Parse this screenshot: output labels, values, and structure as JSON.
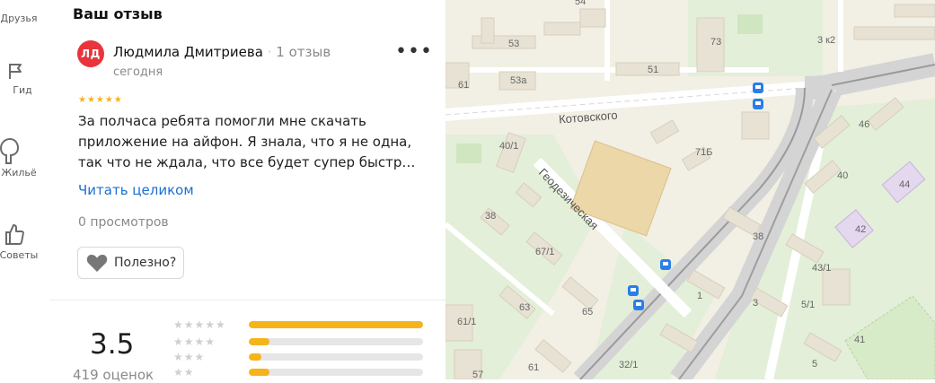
{
  "sidebar": {
    "items": [
      {
        "label": "Друзья",
        "icon": "friends-icon"
      },
      {
        "label": "Гид",
        "icon": "flag-icon"
      },
      {
        "label": "Жильё",
        "icon": "house-icon"
      },
      {
        "label": "Советы",
        "icon": "thumbs-up-icon"
      }
    ]
  },
  "panel": {
    "title": "Ваш отзыв",
    "review": {
      "avatar_initials": "ЛД",
      "author": "Людмила Дмитриева",
      "separator": "·",
      "author_reviews": "1 отзыв",
      "date": "сегодня",
      "stars": "★★★★★",
      "text": "За полчаса ребята помогли мне скачать приложение на айфон. Я знала, что я не одна, так что не ждала, что все будет супер быстр…",
      "read_more": "Читать целиком",
      "views": "0 просмотров",
      "helpful": "Полезно?",
      "more": "•••"
    },
    "rating": {
      "value": "3.5",
      "count": "419 оценок",
      "distribution": [
        {
          "stars": "★★★★★",
          "fraction": 1.0
        },
        {
          "stars": "★★★★",
          "fraction": 0.12
        },
        {
          "stars": "★★★",
          "fraction": 0.07
        },
        {
          "stars": "★★",
          "fraction": 0.12
        }
      ]
    }
  },
  "map": {
    "streets": [
      "Котовского",
      "Геодезическая"
    ],
    "buildings": [
      "54",
      "53",
      "73",
      "3 к2",
      "51",
      "61",
      "53а",
      "46",
      "40/1",
      "71Б",
      "40",
      "44",
      "38",
      "38",
      "42",
      "67/1",
      "43/1",
      "1",
      "5/1",
      "63",
      "65",
      "3",
      "61/1",
      "41",
      "57",
      "61",
      "32/1",
      "5"
    ]
  },
  "colors": {
    "accent": "#f5b41a",
    "link": "#1d6fd1",
    "avatar": "#e8353c",
    "transit": "#2b7de9"
  }
}
